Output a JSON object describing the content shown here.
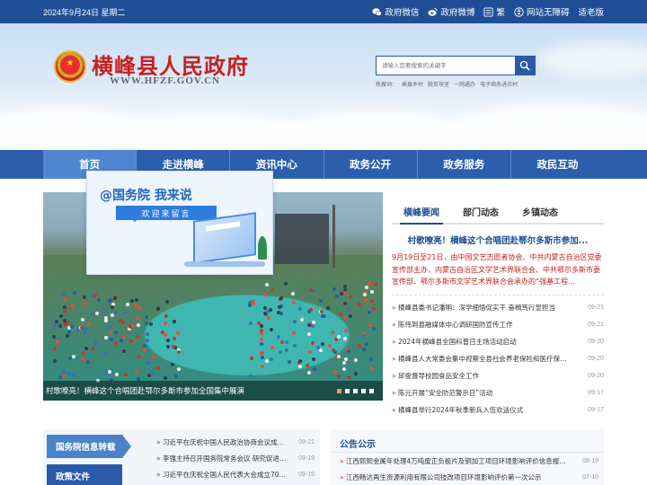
{
  "topbar": {
    "date": "2024年9月24日 星期二",
    "links": [
      {
        "label": "政府微信",
        "icon": "wechat-icon"
      },
      {
        "label": "政府微博",
        "icon": "weibo-icon"
      },
      {
        "label": "繁",
        "icon": "traditional-chinese-icon"
      },
      {
        "label": "网站无障碍",
        "icon": "accessibility-icon"
      },
      {
        "label": "适老版",
        "icon": ""
      }
    ]
  },
  "header": {
    "title": "横峰县人民政府",
    "url": "WWW.HFZF.GOV.CN",
    "search_placeholder": "请输入您要搜索的关键字",
    "hot_words": [
      "热搜词：",
      "乘振乡村",
      "脱贫攻坚",
      "一网通办",
      "电子商务进农村"
    ]
  },
  "nav": {
    "items": [
      "首页",
      "走进横峰",
      "资讯中心",
      "政务公开",
      "政务服务",
      "政民互动"
    ],
    "active": 0
  },
  "promo": {
    "title_prefix": "@国务院",
    "title_suffix": " 我来说",
    "subtitle": "欢迎来留言"
  },
  "carousel": {
    "caption": "村歌嘹亮！横峰这个合唱团赴鄂尔多斯市参加全国集中展演",
    "slides": 5,
    "active": 0
  },
  "news": {
    "tabs": [
      "横峰要闻",
      "部门动态",
      "乡镇动态"
    ],
    "active_tab": 0,
    "headline": "村歌嘹亮！横峰这个合唱团赴鄂尔多斯市参加...",
    "summary": "9月19日至21日，由中国文艺志愿者协会、中共内蒙古自治区党委宣传部主办，内蒙古自治区文学艺术界联合会、中共鄂尔多斯市委宣传部、鄂尔多斯市文学艺术界联合会承办的“强基工程...",
    "items": [
      {
        "title": "横峰县委书记潘明：深学细悟促实干 奋楫笃行显担当",
        "date": "09-21"
      },
      {
        "title": "陈伟到县融媒体中心调研国防宣传工作",
        "date": "09-21"
      },
      {
        "title": "2024年横峰县全国科普日主场活动启动",
        "date": "09-20"
      },
      {
        "title": "横峰县人大常委会集中视察全县社会养老保险和医疗保险工作",
        "date": "09-20"
      },
      {
        "title": "邱俊督导校园食品安全工作",
        "date": "09-20"
      },
      {
        "title": "陈元开展“安全防范警示日”活动",
        "date": "09-17"
      },
      {
        "title": "横峰县举行2024年秋季新兵入伍欢送仪式",
        "date": "09-17"
      }
    ]
  },
  "bottom_left": {
    "tags": [
      "国务院信息转载",
      "政策文件"
    ],
    "items": [
      {
        "title": "习近平在庆祝中国人民政治协商会议成立75周年大会上发表重要讲话",
        "date": "09-21"
      },
      {
        "title": "李强主持召开国务院常务会议 研究促进创业投资高质量发展",
        "date": "09-19"
      },
      {
        "title": "习近平在庆祝全国人民代表大会成立70周年大会上发表重要讲话",
        "date": "09-15"
      }
    ]
  },
  "notices": {
    "title": "公告公示",
    "items": [
      {
        "title": "江西熙熙金属年处理4万吨废正负极片及铜加工项目环境影响评价信息报批前公示",
        "date": "08-19"
      },
      {
        "title": "江西畅达再生资源利用有限公司技改项目环境影响评价第一次公示",
        "date": "07-10"
      }
    ]
  },
  "colors": {
    "primary": "#1f4e96",
    "nav": "#2b5fae",
    "accent_red": "#c81f1f"
  }
}
